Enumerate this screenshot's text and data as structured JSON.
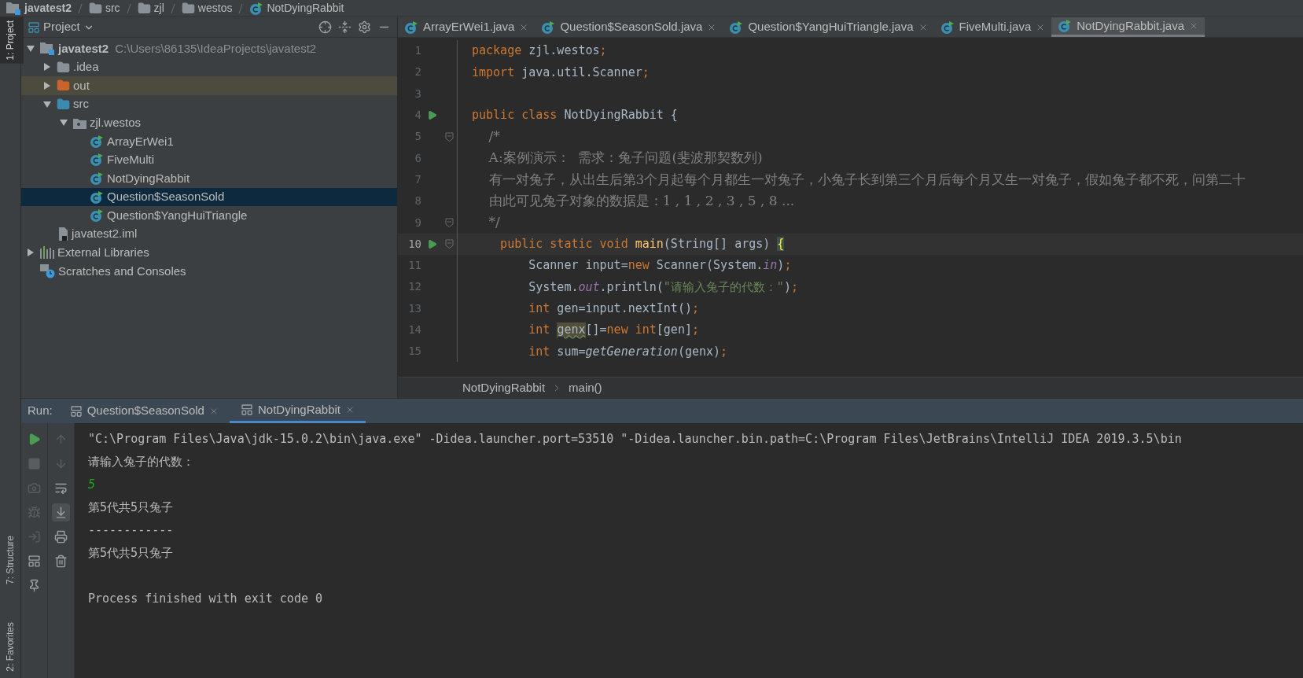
{
  "navbar": [
    {
      "label": "javatest2",
      "kind": "module"
    },
    {
      "label": "src",
      "kind": "folder"
    },
    {
      "label": "zjl",
      "kind": "folder"
    },
    {
      "label": "westos",
      "kind": "folder"
    },
    {
      "label": "NotDyingRabbit",
      "kind": "class"
    }
  ],
  "side_strip": {
    "top": [
      {
        "label": "1: Project",
        "selected": true
      }
    ],
    "bottom": [
      {
        "label": "7: Structure",
        "selected": false
      },
      {
        "label": "2: Favorites",
        "selected": false
      }
    ]
  },
  "project_panel": {
    "title": "Project",
    "tree": [
      {
        "label": "javatest2",
        "path": "C:\\Users\\86135\\IdeaProjects\\javatest2",
        "kind": "module",
        "expanded": true,
        "selected": false,
        "children": [
          {
            "label": ".idea",
            "kind": "folder",
            "expanded": false,
            "selected": false
          },
          {
            "label": "out",
            "kind": "excluded-folder",
            "expanded": false,
            "selected": false
          },
          {
            "label": "src",
            "kind": "source-folder",
            "expanded": true,
            "selected": false,
            "children": [
              {
                "label": "zjl.westos",
                "kind": "package",
                "expanded": true,
                "selected": false,
                "children": [
                  {
                    "label": "ArrayErWei1",
                    "kind": "class",
                    "selected": false
                  },
                  {
                    "label": "FiveMulti",
                    "kind": "class",
                    "selected": false
                  },
                  {
                    "label": "NotDyingRabbit",
                    "kind": "class",
                    "selected": false
                  },
                  {
                    "label": "Question$SeasonSold",
                    "kind": "class",
                    "selected": true
                  },
                  {
                    "label": "Question$YangHuiTriangle",
                    "kind": "class",
                    "selected": false
                  }
                ]
              }
            ]
          },
          {
            "label": "javatest2.iml",
            "kind": "iml",
            "selected": false
          }
        ]
      },
      {
        "label": "External Libraries",
        "kind": "libraries",
        "expanded": false,
        "selected": false
      },
      {
        "label": "Scratches and Consoles",
        "kind": "scratches",
        "selected": false
      }
    ]
  },
  "editor_tabs": [
    {
      "label": "ArrayErWei1.java",
      "selected": false
    },
    {
      "label": "Question$SeasonSold.java",
      "selected": false
    },
    {
      "label": "Question$YangHuiTriangle.java",
      "selected": false
    },
    {
      "label": "FiveMulti.java",
      "selected": false
    },
    {
      "label": "NotDyingRabbit.java",
      "selected": true
    }
  ],
  "code_lines": [
    {
      "number": "1",
      "tokens": [
        {
          "kind": "keyword",
          "text": "package"
        },
        {
          "kind": "plain",
          "text": " zjl.westos"
        },
        {
          "kind": "punct",
          "text": ";"
        }
      ]
    },
    {
      "number": "2",
      "tokens": [
        {
          "kind": "keyword",
          "text": "import"
        },
        {
          "kind": "plain",
          "text": " java.util.Scanner"
        },
        {
          "kind": "punct",
          "text": ";"
        }
      ]
    },
    {
      "number": "3"
    },
    {
      "number": "4",
      "run": true,
      "tokens": [
        {
          "kind": "keyword",
          "text": "public class"
        },
        {
          "kind": "plain",
          "text": " NotDyingRabbit {"
        }
      ]
    },
    {
      "number": "5",
      "fold": true,
      "tokens": [
        {
          "kind": "comment",
          "text": "    /*"
        }
      ]
    },
    {
      "number": "6",
      "tokens": [
        {
          "kind": "comment",
          "text": "    A:案例演示：  需求：兔子问题(斐波那契数列)"
        }
      ]
    },
    {
      "number": "7",
      "tokens": [
        {
          "kind": "comment",
          "text": "    有一对兔子，从出生后第3个月起每个月都生一对兔子，小兔子长到第三个月后每个月又生一对兔子，假如兔子都不死，问第二十"
        }
      ]
    },
    {
      "number": "8",
      "tokens": [
        {
          "kind": "comment",
          "text": "    由此可见兔子对象的数据是：1 , 1 , 2 , 3 , 5 , 8 ..."
        }
      ]
    },
    {
      "number": "9",
      "fold": true,
      "tokens": [
        {
          "kind": "comment",
          "text": "    */"
        }
      ]
    },
    {
      "number": "10",
      "run": true,
      "fold": true,
      "current": true,
      "tokens": [
        {
          "kind": "keyword",
          "text": "    public static void "
        },
        {
          "kind": "method",
          "text": "main"
        },
        {
          "kind": "plain",
          "text": "(String[] args) "
        },
        {
          "kind": "brace",
          "text": "{"
        }
      ]
    },
    {
      "number": "11",
      "tokens": [
        {
          "kind": "plain",
          "text": "        Scanner input="
        },
        {
          "kind": "keyword",
          "text": "new"
        },
        {
          "kind": "plain",
          "text": " Scanner(System."
        },
        {
          "kind": "static",
          "text": "in"
        },
        {
          "kind": "plain",
          "text": ")"
        },
        {
          "kind": "punct",
          "text": ";"
        }
      ]
    },
    {
      "number": "12",
      "tokens": [
        {
          "kind": "plain",
          "text": "        System."
        },
        {
          "kind": "static",
          "text": "out"
        },
        {
          "kind": "plain",
          "text": ".println("
        },
        {
          "kind": "string",
          "text": "\"请输入兔子的代数：\""
        },
        {
          "kind": "plain",
          "text": ")"
        },
        {
          "kind": "punct",
          "text": ";"
        }
      ]
    },
    {
      "number": "13",
      "tokens": [
        {
          "kind": "keyword",
          "text": "        int"
        },
        {
          "kind": "plain",
          "text": " gen=input.nextInt()"
        },
        {
          "kind": "punct",
          "text": ";"
        }
      ]
    },
    {
      "number": "14",
      "tokens": [
        {
          "kind": "keyword",
          "text": "        int "
        },
        {
          "kind": "warning",
          "text": "genx"
        },
        {
          "kind": "plain",
          "text": "[]="
        },
        {
          "kind": "keyword",
          "text": "new int"
        },
        {
          "kind": "plain",
          "text": "[gen]"
        },
        {
          "kind": "punct",
          "text": ";"
        }
      ]
    },
    {
      "number": "15",
      "tokens": [
        {
          "kind": "keyword",
          "text": "        int"
        },
        {
          "kind": "plain",
          "text": " sum="
        },
        {
          "kind": "call",
          "text": "getGeneration"
        },
        {
          "kind": "plain",
          "text": "(genx)"
        },
        {
          "kind": "punct",
          "text": ";"
        }
      ]
    }
  ],
  "editor_breadcrumb": [
    "NotDyingRabbit",
    "main()"
  ],
  "run_panel": {
    "label": "Run:",
    "tabs": [
      {
        "label": "Question$SeasonSold",
        "selected": false
      },
      {
        "label": "NotDyingRabbit",
        "selected": true
      }
    ],
    "console": [
      {
        "kind": "output",
        "text": "\"C:\\Program Files\\Java\\jdk-15.0.2\\bin\\java.exe\" -Didea.launcher.port=53510 \"-Didea.launcher.bin.path=C:\\Program Files\\JetBrains\\IntelliJ IDEA 2019.3.5\\bin"
      },
      {
        "kind": "output",
        "text": "请输入兔子的代数："
      },
      {
        "kind": "input",
        "text": "5"
      },
      {
        "kind": "output",
        "text": "第5代共5只兔子"
      },
      {
        "kind": "output",
        "text": "------------"
      },
      {
        "kind": "output",
        "text": "第5代共5只兔子"
      },
      {
        "kind": "blank"
      },
      {
        "kind": "output",
        "text": "Process finished with exit code 0"
      }
    ]
  }
}
